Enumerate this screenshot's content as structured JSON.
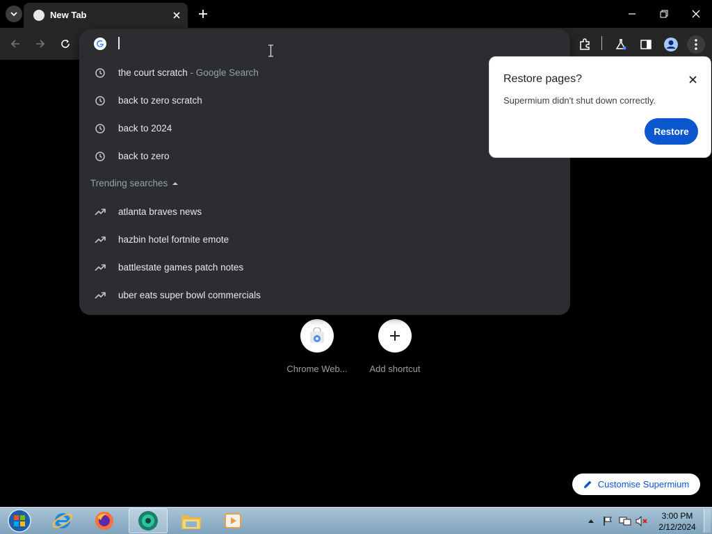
{
  "window": {
    "tab_title": "New Tab"
  },
  "omnibox": {
    "value": "",
    "history": [
      {
        "text": "the court scratch",
        "sub": " - Google Search"
      },
      {
        "text": "back to zero scratch",
        "sub": ""
      },
      {
        "text": "back to 2024",
        "sub": ""
      },
      {
        "text": "back to zero",
        "sub": ""
      }
    ],
    "trending_header": "Trending searches",
    "trending": [
      {
        "text": "atlanta braves news"
      },
      {
        "text": "hazbin hotel fortnite emote"
      },
      {
        "text": "battlestate games patch notes"
      },
      {
        "text": "uber eats super bowl commercials"
      }
    ]
  },
  "restore_popup": {
    "title": "Restore pages?",
    "message": "Supermium didn't shut down correctly.",
    "button": "Restore"
  },
  "shortcuts": [
    {
      "label": "Chrome Web...",
      "icon": "chrome-web-store-icon"
    },
    {
      "label": "Add shortcut",
      "icon": "plus-icon"
    }
  ],
  "customise": {
    "label": "Customise Supermium"
  },
  "taskbar": {
    "items": [
      "start-orb",
      "internet-explorer-icon",
      "firefox-icon",
      "supermium-icon",
      "file-explorer-icon",
      "media-player-icon"
    ],
    "clock_time": "3:00 PM",
    "clock_date": "2/12/2024"
  },
  "colors": {
    "accent": "#0b57d0",
    "toolbar": "#262626",
    "omnibox_bg": "#2c2d31"
  }
}
